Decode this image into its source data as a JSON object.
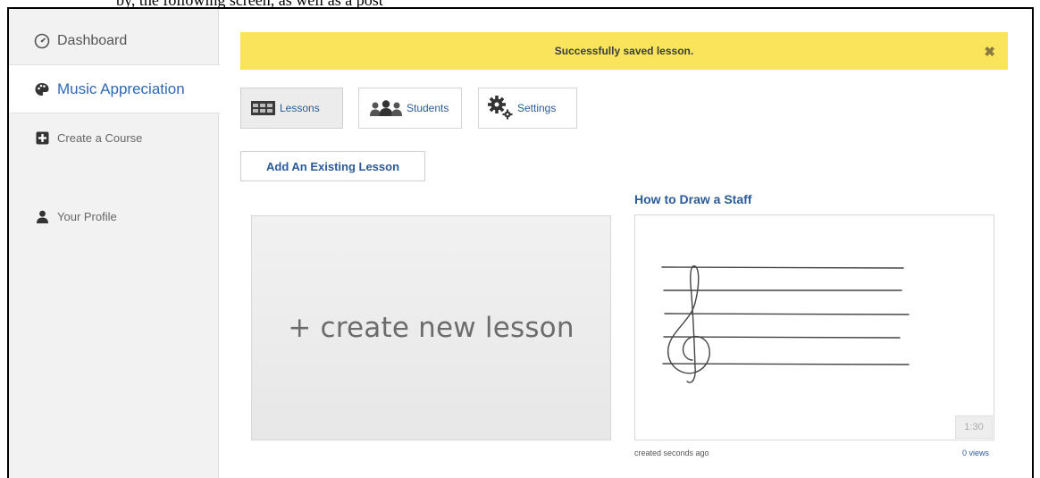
{
  "page_top_text": "by, the following screen, as well as a post",
  "sidebar": {
    "items": [
      {
        "label": "Dashboard",
        "icon": "dashboard-icon"
      },
      {
        "label": "Music Appreciation",
        "icon": "palette-icon"
      },
      {
        "label": "Create a Course",
        "icon": "plus-square-icon"
      },
      {
        "label": "Your Profile",
        "icon": "user-icon"
      }
    ]
  },
  "alert": {
    "message": "Successfully saved lesson.",
    "close": "✖"
  },
  "tabs": [
    {
      "label": "Lessons",
      "icon": "lessons-icon"
    },
    {
      "label": "Students",
      "icon": "students-icon"
    },
    {
      "label": "Settings",
      "icon": "gears-icon"
    }
  ],
  "add_existing_label": "Add An Existing Lesson",
  "create_card_label": "+ create new lesson",
  "lesson": {
    "title": "How to Draw a Staff",
    "duration": "1:30",
    "created": "created seconds ago",
    "views": "0 views"
  },
  "colors": {
    "accent_blue": "#2a5a9a",
    "alert_yellow": "#f9e45c",
    "sidebar_bg": "#f2f2f2"
  }
}
